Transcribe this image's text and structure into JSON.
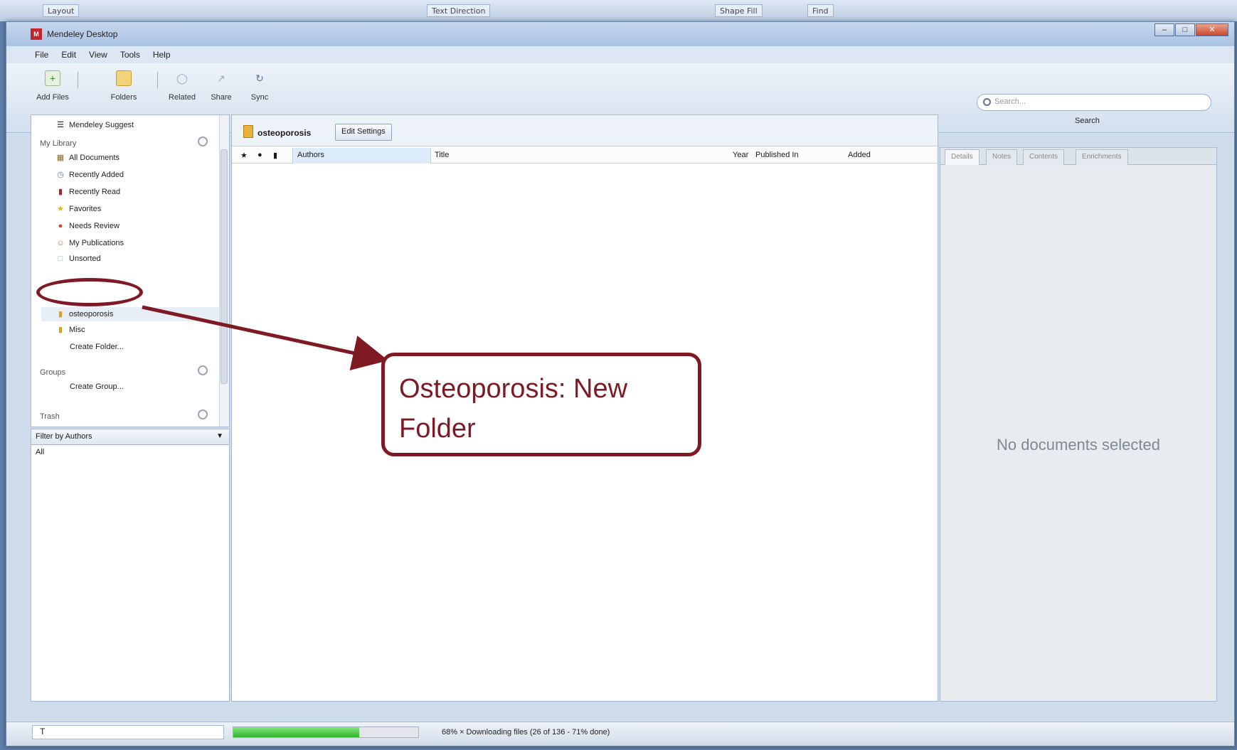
{
  "background": {
    "items": [
      "Layout",
      "Text Direction",
      "Shape Fill",
      "Find"
    ]
  },
  "window": {
    "title": "Mendeley Desktop",
    "controls": {
      "minimize": "–",
      "maximize": "□",
      "close": "✕"
    }
  },
  "menu": [
    "File",
    "Edit",
    "View",
    "Tools",
    "Help"
  ],
  "toolbar": {
    "buttons": [
      {
        "label": "Add Files",
        "icon": "add-files-icon"
      },
      {
        "label": "Folders",
        "icon": "folder-add-icon"
      },
      {
        "label": "Related",
        "icon": "related-icon"
      },
      {
        "label": "Share",
        "icon": "share-icon"
      },
      {
        "label": "Sync",
        "icon": "sync-icon"
      }
    ],
    "search_placeholder": "Search...",
    "search_label": "Search"
  },
  "sidebar": {
    "top_item": "Mendeley Suggest",
    "my_library_heading": "My Library",
    "items": [
      {
        "label": "All Documents",
        "icon": "documents-icon"
      },
      {
        "label": "Recently Added",
        "icon": "clock-icon"
      },
      {
        "label": "Recently Read",
        "icon": "book-icon"
      },
      {
        "label": "Favorites",
        "icon": "star-icon"
      },
      {
        "label": "Needs Review",
        "icon": "review-icon"
      },
      {
        "label": "My Publications",
        "icon": "person-icon"
      },
      {
        "label": "Unsorted",
        "icon": "unsorted-icon"
      },
      {
        "label": "osteoporosis",
        "icon": "folder-icon"
      },
      {
        "label": "Misc",
        "icon": "folder-icon"
      },
      {
        "label": "Create Folder...",
        "icon": ""
      }
    ],
    "groups_heading": "Groups",
    "create_group": "Create Group...",
    "trash": "Trash"
  },
  "filter": {
    "title": "Filter by Authors",
    "all": "All"
  },
  "center": {
    "folder": "osteoporosis",
    "edit_settings": "Edit Settings",
    "columns": [
      "Authors",
      "Title",
      "Year",
      "Published In",
      "Added"
    ]
  },
  "right": {
    "tabs": [
      "Details",
      "Notes",
      "Contents",
      "Enrichments"
    ],
    "empty": "No documents selected"
  },
  "status": {
    "filter_symbol": "T",
    "progress_percent": 68,
    "text": "68%  × Downloading files (26 of 136 - 71% done)"
  },
  "annotation": {
    "callout": "Osteoporosis: New Folder"
  },
  "colors": {
    "annotation": "#7f1a24",
    "progress": "#2fb52a",
    "selection": "#dcecfb"
  }
}
